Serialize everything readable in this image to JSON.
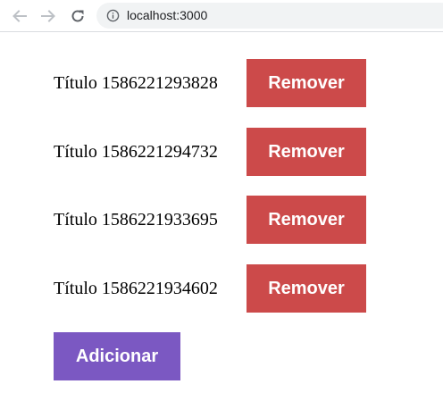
{
  "browser": {
    "url": "localhost:3000",
    "icons": {
      "back": "arrow-back-icon",
      "forward": "arrow-forward-icon",
      "reload": "reload-icon",
      "info": "info-icon"
    }
  },
  "items": [
    {
      "title": "Título 1586221293828",
      "remove_label": "Remover"
    },
    {
      "title": "Título 1586221294732",
      "remove_label": "Remover"
    },
    {
      "title": "Título 1586221933695",
      "remove_label": "Remover"
    },
    {
      "title": "Título 1586221934602",
      "remove_label": "Remover"
    }
  ],
  "add_label": "Adicionar",
  "colors": {
    "remove_button": "#cc4a4a",
    "add_button": "#7b58c2",
    "button_text": "#ffffff"
  }
}
